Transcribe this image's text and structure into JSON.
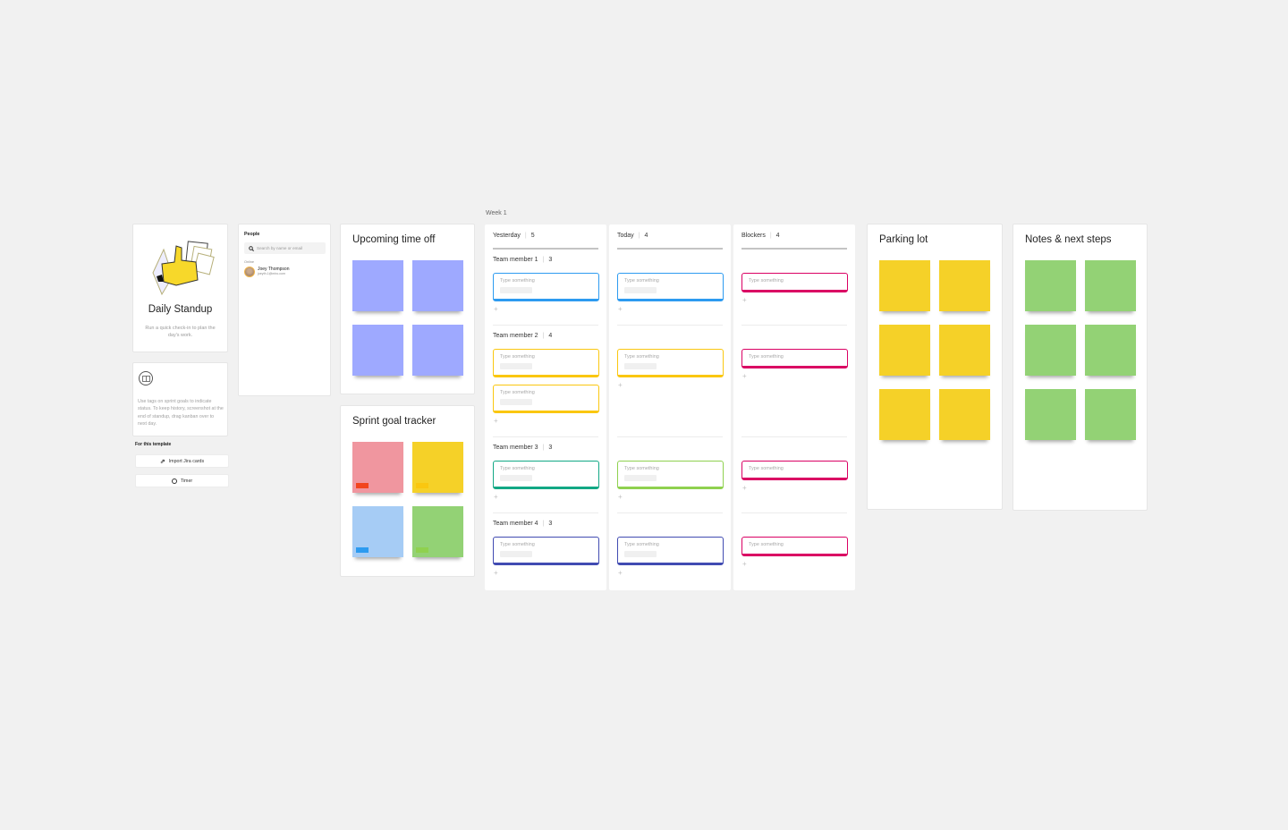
{
  "intro": {
    "title": "Daily Standup",
    "description": "Run a quick check-in to plan the day's work."
  },
  "info": {
    "icon": "book-icon",
    "description": "Use tags on sprint goals to indicate status. To keep history, screenshot at the end of standup, drag kanban over to next day."
  },
  "template_actions": {
    "heading": "For this template",
    "buttons": [
      {
        "label": "Import Jira cards",
        "icon": "jira-icon"
      },
      {
        "label": "Timer",
        "icon": "timer-icon"
      }
    ]
  },
  "people": {
    "heading": "People",
    "search_placeholder": "Search by name or email",
    "section": "Online",
    "members": [
      {
        "name": "Joey Thompson",
        "email": "joeyth.1@miro.com"
      }
    ]
  },
  "frames": {
    "timeoff": {
      "title": "Upcoming time off",
      "color": "#9ea9ff",
      "count": 4
    },
    "sprint": {
      "title": "Sprint goal tracker",
      "stickies": [
        {
          "color": "#f0969f",
          "tag_color": "#f2451e"
        },
        {
          "color": "#f5d128",
          "tag_color": "#fac710"
        },
        {
          "color": "#a6ccf5",
          "tag_color": "#2d9bf0"
        },
        {
          "color": "#93d275",
          "tag_color": "#8fd14f"
        }
      ]
    },
    "parking": {
      "title": "Parking lot",
      "color": "#f5d128",
      "count": 6
    },
    "notes": {
      "title": "Notes & next steps",
      "color": "#93d275",
      "count": 6
    }
  },
  "kanban": {
    "week_label": "Week 1",
    "placeholder": "Type something",
    "columns": [
      {
        "title": "Yesterday",
        "count": "5"
      },
      {
        "title": "Today",
        "count": "4"
      },
      {
        "title": "Blockers",
        "count": "4"
      }
    ],
    "members": [
      {
        "label": "Team member 1",
        "count": "3",
        "color": "#2d9bf0"
      },
      {
        "label": "Team member 2",
        "count": "4",
        "color": "#fac710"
      },
      {
        "label": "Team member 3",
        "count": "3",
        "color": "#12cdd4"
      },
      {
        "label": "Team member 4",
        "count": "3",
        "color": "#414bb2"
      }
    ],
    "colors": {
      "yesterday": [
        "#2d9bf0",
        "#fac710",
        "#12a885",
        "#414bb2"
      ],
      "today": [
        "#2d9bf0",
        "#fac710",
        "#8fd14f",
        "#414bb2"
      ],
      "blockers": "#da0063"
    }
  }
}
